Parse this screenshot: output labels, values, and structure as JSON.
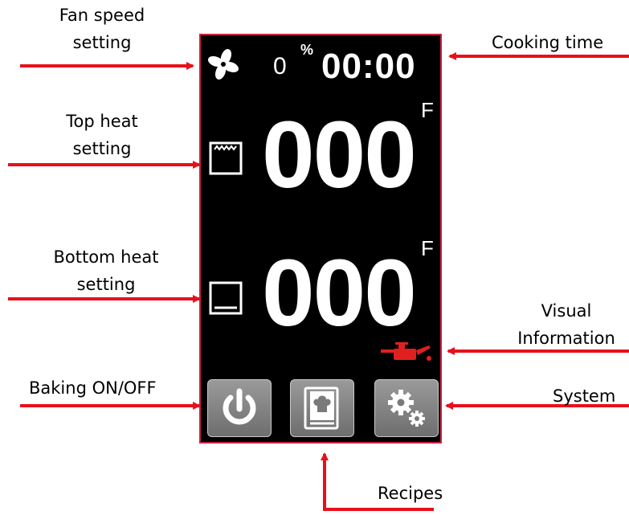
{
  "callouts": {
    "fan_speed": [
      "Fan speed",
      "setting"
    ],
    "cooking_time": "Cooking time",
    "top_heat": [
      "Top heat",
      "setting"
    ],
    "bottom_heat": [
      "Bottom heat",
      "setting"
    ],
    "visual_info": [
      "Visual",
      "Information"
    ],
    "baking": "Baking ON/OFF",
    "system": "System",
    "recipes": "Recipes"
  },
  "display": {
    "fan_value": "0",
    "fan_unit": "%",
    "time": "00:00",
    "top_temp": "000",
    "top_unit": "F",
    "bottom_temp": "000",
    "bottom_unit": "F"
  },
  "icons": [
    "fan-icon",
    "top-heat-icon",
    "bottom-heat-icon",
    "oil-can-icon",
    "power-icon",
    "recipe-book-icon",
    "gears-icon"
  ],
  "colors": {
    "arrow": "#e8101a",
    "panel_border": "#c62040",
    "panel_bg": "#000000",
    "warning_icon": "#e02020",
    "button": "#8a8a8a"
  }
}
